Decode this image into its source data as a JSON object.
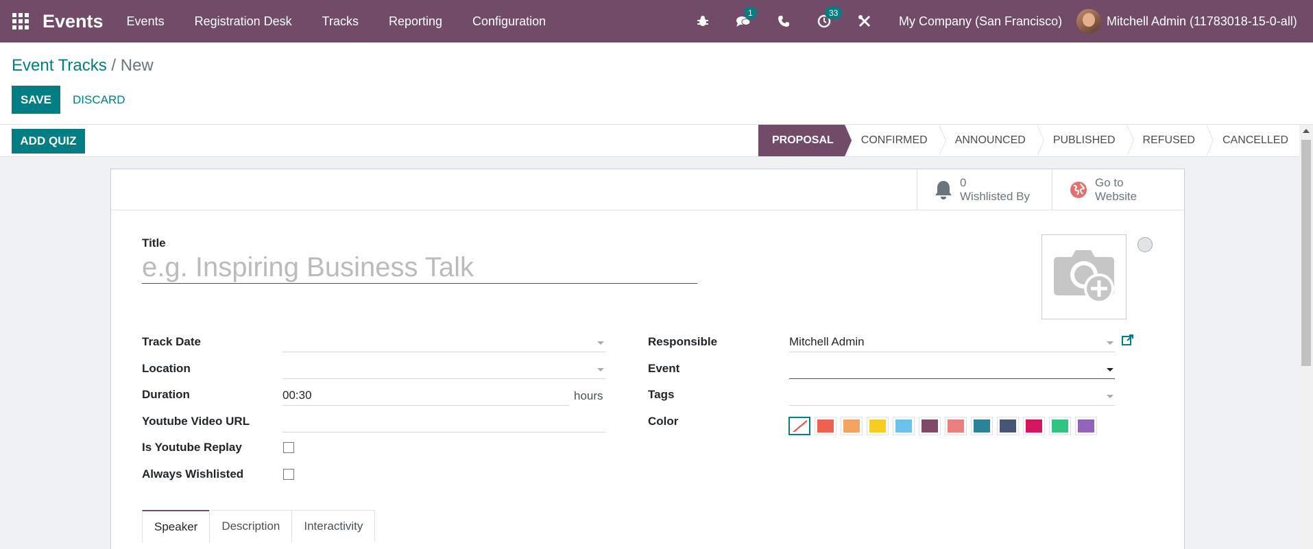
{
  "navbar": {
    "brand": "Events",
    "menu": [
      "Events",
      "Registration Desk",
      "Tracks",
      "Reporting",
      "Configuration"
    ],
    "messages_badge": "1",
    "activity_badge": "33",
    "company": "My Company (San Francisco)",
    "user": "Mitchell Admin (11783018-15-0-all)"
  },
  "breadcrumb": {
    "parent": "Event Tracks",
    "separator": " / ",
    "current": "New"
  },
  "buttons": {
    "save": "SAVE",
    "discard": "DISCARD",
    "add_quiz": "ADD QUIZ"
  },
  "stages": [
    {
      "label": "PROPOSAL",
      "active": true
    },
    {
      "label": "CONFIRMED",
      "active": false
    },
    {
      "label": "ANNOUNCED",
      "active": false
    },
    {
      "label": "PUBLISHED",
      "active": false
    },
    {
      "label": "REFUSED",
      "active": false
    },
    {
      "label": "CANCELLED",
      "active": false
    }
  ],
  "stat_buttons": {
    "wishlist_count": "0",
    "wishlist_label": "Wishlisted By",
    "website_line1": "Go to",
    "website_line2": "Website"
  },
  "form": {
    "title_label": "Title",
    "title_placeholder": "e.g. Inspiring Business Talk",
    "track_date_label": "Track Date",
    "location_label": "Location",
    "duration_label": "Duration",
    "duration_value": "00:30",
    "duration_unit": "hours",
    "youtube_url_label": "Youtube Video URL",
    "youtube_replay_label": "Is Youtube Replay",
    "always_wishlisted_label": "Always Wishlisted",
    "responsible_label": "Responsible",
    "responsible_value": "Mitchell Admin",
    "event_label": "Event",
    "tags_label": "Tags",
    "color_label": "Color"
  },
  "colors": [
    "#f06050",
    "#f4a460",
    "#f7cd1f",
    "#6cc1ed",
    "#814968",
    "#eb7e7f",
    "#2c8397",
    "#475577",
    "#d6145f",
    "#30c381",
    "#9365b8"
  ],
  "tabs": [
    "Speaker",
    "Description",
    "Interactivity"
  ],
  "theme": {
    "primary": "#714b67",
    "accent": "#017e84"
  }
}
